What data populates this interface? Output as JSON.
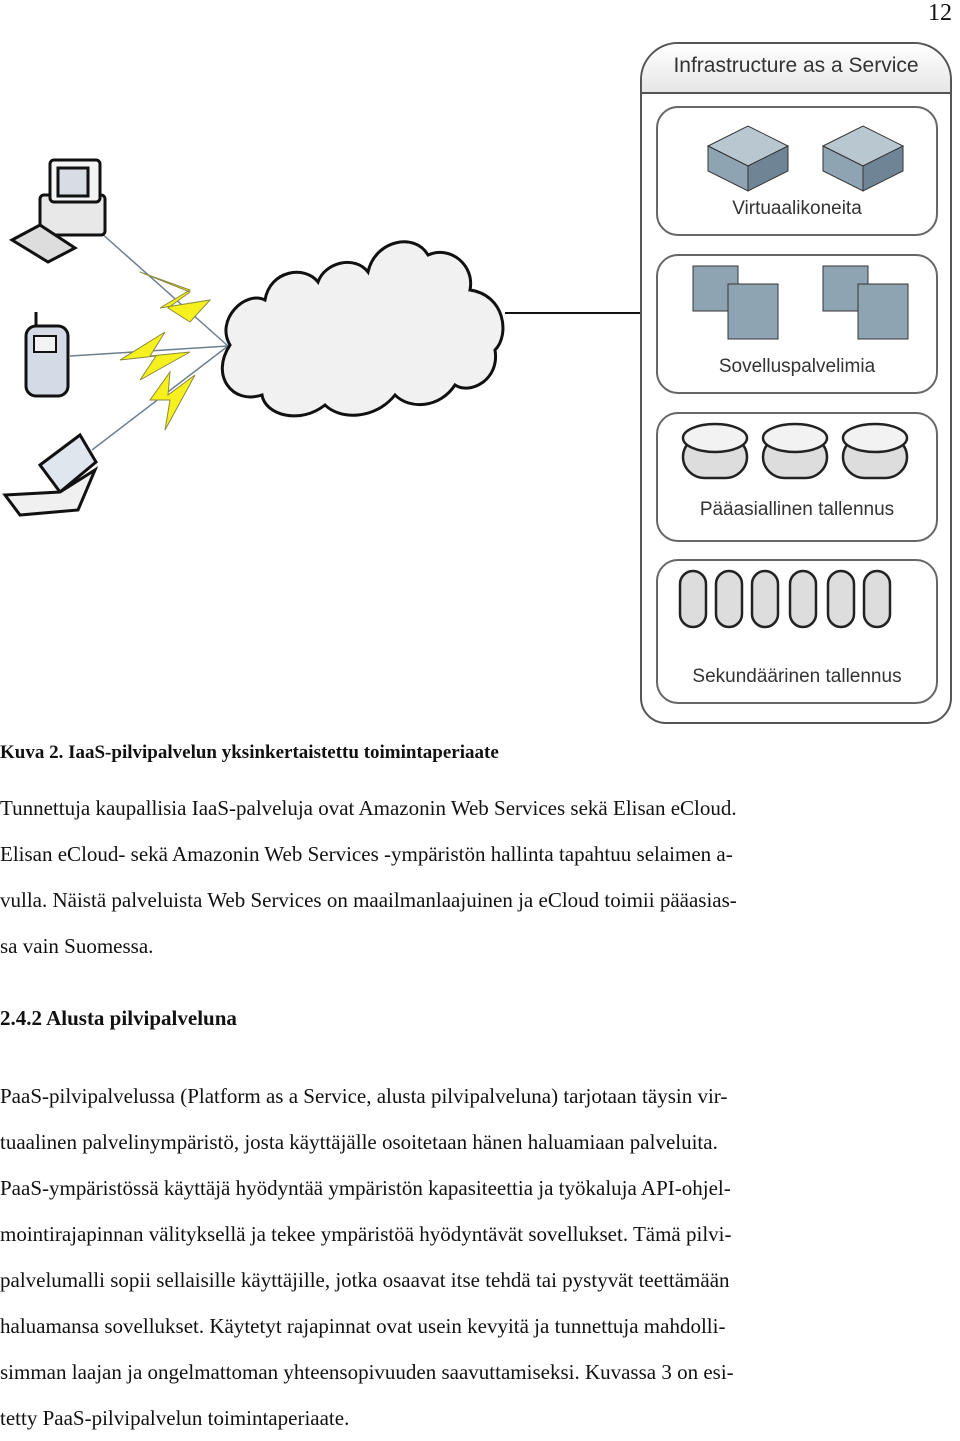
{
  "page_number": "12",
  "diagram": {
    "clients": [
      "desktop-computer",
      "mobile-phone",
      "laptop"
    ],
    "network": "cloud",
    "iaas_title": "Infrastructure as a Service",
    "groups": [
      {
        "label": "Virtuaalikoneita",
        "icon": "server",
        "count": 2
      },
      {
        "label": "Sovelluspalvelimia",
        "icon": "server-stack",
        "count": 2
      },
      {
        "label": "Pääasiallinen tallennus",
        "icon": "disk",
        "count": 3
      },
      {
        "label": "Sekundäärinen tallennus",
        "icon": "disk-small",
        "count": 6
      }
    ],
    "colors": {
      "lightning": "#f5f01e",
      "server": "#8fa4b3"
    }
  },
  "caption": "Kuva 2. IaaS-pilvipalvelun yksinkertaistettu toimintaperiaate",
  "paragraph1": [
    "Tunnettuja kaupallisia IaaS-palveluja ovat Amazonin Web Services sekä Elisan eCloud.",
    "Elisan eCloud- sekä Amazonin Web Services -ympäristön hallinta tapahtuu selaimen a-",
    "vulla. Näistä palveluista Web Services on maailmanlaajuinen ja eCloud toimii pääasias-",
    "sa vain Suomessa."
  ],
  "heading": "2.4.2 Alusta pilvipalveluna",
  "paragraph2": [
    "PaaS-pilvipalvelussa (Platform as a Service, alusta pilvipalveluna) tarjotaan täysin vir-",
    "tuaalinen palvelinympäristö, josta käyttäjälle osoitetaan hänen haluamiaan palveluita.",
    "PaaS-ympäristössä käyttäjä hyödyntää ympäristön kapasiteettia ja työkaluja API-ohjel-",
    "mointirajapinnan välityksellä ja tekee ympäristöä hyödyntävät sovellukset. Tämä pilvi-",
    "palvelumalli sopii sellaisille käyttäjille, jotka osaavat itse tehdä tai pystyvät teettämään",
    "haluamansa sovellukset. Käytetyt rajapinnat ovat usein kevyitä ja tunnettuja mahdolli-",
    "simman laajan ja ongelmattoman yhteensopivuuden saavuttamiseksi. Kuvassa 3 on esi-",
    "tetty PaaS-pilvipalvelun toimintaperiaate."
  ]
}
